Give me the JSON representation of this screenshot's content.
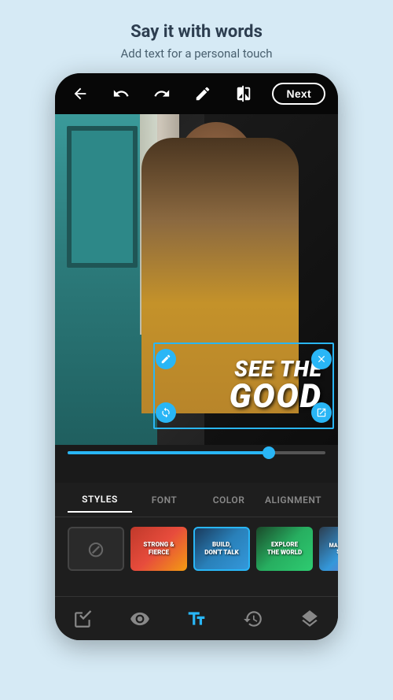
{
  "header": {
    "title": "Say it with words",
    "subtitle": "Add text for a personal touch"
  },
  "toolbar": {
    "next_label": "Next"
  },
  "text_overlay": {
    "line1": "SEE THE",
    "line2": "GOOD"
  },
  "tabs": {
    "items": [
      {
        "label": "STYLES",
        "active": true
      },
      {
        "label": "FONT",
        "active": false
      },
      {
        "label": "COLOR",
        "active": false
      },
      {
        "label": "ALIGNMENT",
        "active": false
      }
    ]
  },
  "styles": {
    "items": [
      {
        "id": "none",
        "type": "empty"
      },
      {
        "id": "strong-fierce",
        "label": "STRONG & FIERCE",
        "type": "red-fire"
      },
      {
        "id": "build-dont-talk",
        "label": "BUILD, DON'T TALK",
        "type": "blue-city",
        "selected": true
      },
      {
        "id": "explore-world",
        "label": "EXPLORE THE WORLD",
        "type": "green"
      },
      {
        "id": "make-it",
        "label": "MAKE IT SIG... SIGNIF...",
        "type": "dark-purple"
      }
    ]
  },
  "nav": {
    "items": [
      {
        "id": "sticker",
        "icon": "sticker"
      },
      {
        "id": "eye",
        "icon": "eye"
      },
      {
        "id": "text",
        "icon": "text",
        "active": true
      },
      {
        "id": "history",
        "icon": "history"
      },
      {
        "id": "layers",
        "icon": "layers"
      }
    ]
  }
}
